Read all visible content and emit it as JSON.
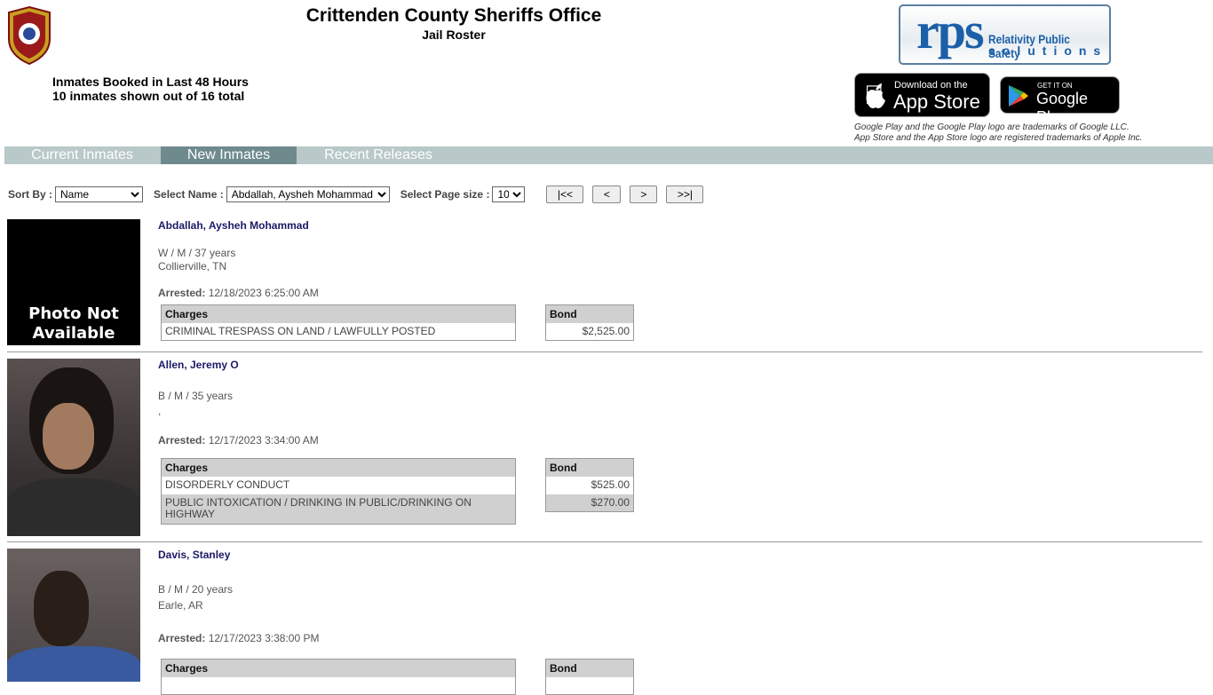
{
  "header": {
    "title": "Crittenden County Sheriffs Office",
    "subtitle": "Jail Roster",
    "info_line1": "Inmates Booked in Last 48 Hours",
    "info_line2": "10 inmates shown out of 16 total"
  },
  "logo": {
    "rps": "rps",
    "rps_line1": "Relativity Public Safety",
    "rps_line2": "solutions"
  },
  "stores": {
    "apple_small": "Download on the",
    "apple_big": "App Store",
    "google_small": "GET IT ON",
    "google_big": "Google Play",
    "trademark1": "Google Play and the Google Play logo are trademarks of Google LLC.",
    "trademark2": "App Store and the App Store logo are registered trademarks of Apple Inc."
  },
  "tabs": [
    {
      "label": "Current Inmates"
    },
    {
      "label": "New Inmates",
      "active": true
    },
    {
      "label": "Recent Releases"
    }
  ],
  "toolbar": {
    "sort_label": "Sort By :",
    "sort_value": "Name",
    "name_label": "Select Name :",
    "name_value": "Abdallah, Aysheh Mohammad",
    "size_label": "Select Page size :",
    "size_value": "10",
    "first": "|<<",
    "prev": "<",
    "next": ">",
    "last": ">>|"
  },
  "labels": {
    "arrested": "Arrested:",
    "charges": "Charges",
    "bond": "Bond",
    "photo_na": "Photo Not Available"
  },
  "inmates": [
    {
      "name": "Abdallah, Aysheh Mohammad",
      "demo": "W / M / 37 years",
      "city": "Collierville, TN",
      "arrested": "12/18/2023 6:25:00 AM",
      "charges": [
        {
          "charge": "CRIMINAL TRESPASS ON LAND / LAWFULLY POSTED",
          "bond": "$2,525.00"
        }
      ]
    },
    {
      "name": "Allen, Jeremy O",
      "demo": "B / M / 35 years",
      "city": ",",
      "arrested": "12/17/2023 3:34:00 AM",
      "charges": [
        {
          "charge": "DISORDERLY CONDUCT",
          "bond": "$525.00"
        },
        {
          "charge": "PUBLIC INTOXICATION / DRINKING IN PUBLIC/DRINKING ON HIGHWAY",
          "bond": "$270.00"
        }
      ]
    },
    {
      "name": "Davis, Stanley",
      "demo": "B / M / 20 years",
      "city": "Earle, AR",
      "arrested": "12/17/2023 3:38:00 PM",
      "charges": []
    }
  ]
}
